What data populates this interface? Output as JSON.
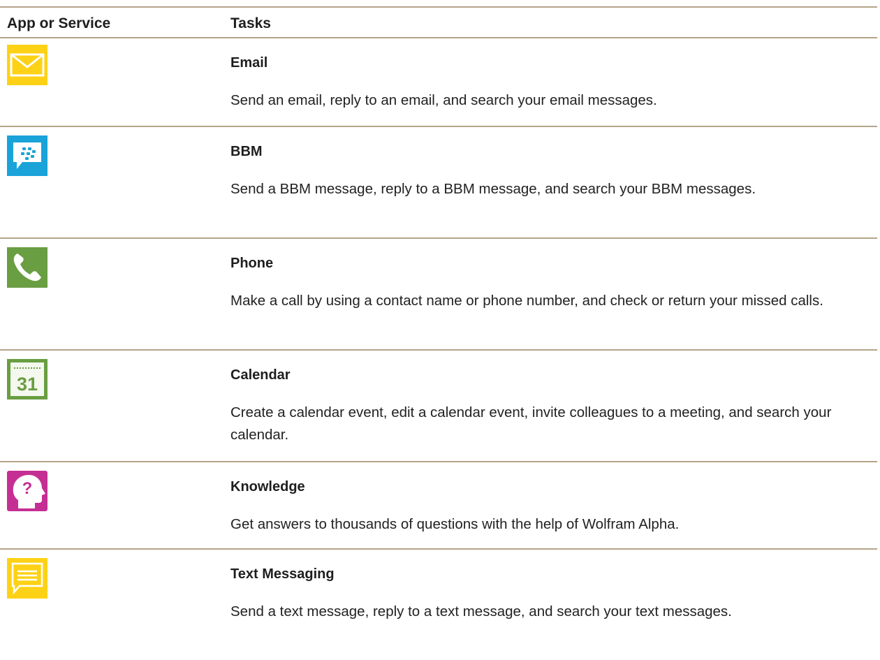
{
  "header": {
    "col_app": "App or Service",
    "col_tasks": "Tasks"
  },
  "rows": [
    {
      "icon": "email-icon",
      "name": "Email",
      "description": "Send an email, reply to an email, and search your email messages."
    },
    {
      "icon": "bbm-icon",
      "name": "BBM",
      "description": "Send a BBM message, reply to a BBM message, and search your BBM messages."
    },
    {
      "icon": "phone-icon",
      "name": "Phone",
      "description": "Make a call by using a contact name or phone number, and check or return your missed calls."
    },
    {
      "icon": "calendar-icon",
      "name": "Calendar",
      "description": "Create a calendar event, edit a calendar event, invite colleagues to a meeting, and search your calendar.",
      "icon_text": "31"
    },
    {
      "icon": "knowledge-icon",
      "name": "Knowledge",
      "description": "Get answers to thousands of questions with the help of Wolfram Alpha.",
      "icon_text": "?"
    },
    {
      "icon": "text-messaging-icon",
      "name": "Text Messaging",
      "description": "Send a text message, reply to a text message, and search your text messages."
    }
  ],
  "colors": {
    "email": "#fdd216",
    "bbm": "#1aa3d9",
    "phone": "#6a9e42",
    "calendar": "#6a9e42",
    "knowledge": "#c52f93",
    "text_messaging": "#fdd216",
    "divider": "#b5a48a"
  }
}
